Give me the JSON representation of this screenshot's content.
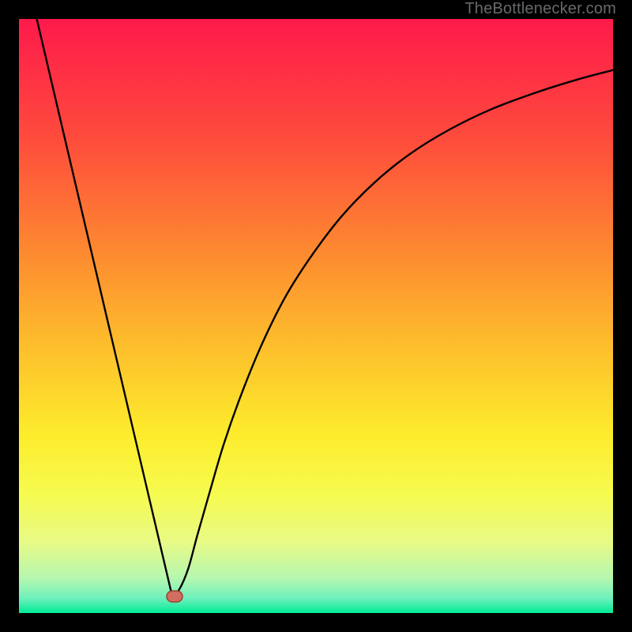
{
  "attribution": "TheBottlenecker.com",
  "chart_data": {
    "type": "line",
    "title": "",
    "xlabel": "",
    "ylabel": "",
    "xlim": [
      0,
      1
    ],
    "ylim": [
      0,
      1
    ],
    "background": {
      "type": "vertical-gradient",
      "stops": [
        {
          "pos": 0.0,
          "color": "#FE1A4B"
        },
        {
          "pos": 0.2,
          "color": "#FE4B3C"
        },
        {
          "pos": 0.4,
          "color": "#FD8C30"
        },
        {
          "pos": 0.55,
          "color": "#FDBE2C"
        },
        {
          "pos": 0.7,
          "color": "#FDEC2C"
        },
        {
          "pos": 0.8,
          "color": "#F6FB4F"
        },
        {
          "pos": 0.88,
          "color": "#E8FA85"
        },
        {
          "pos": 0.94,
          "color": "#B7F7AF"
        },
        {
          "pos": 0.975,
          "color": "#6FF1BC"
        },
        {
          "pos": 1.0,
          "color": "#00EB96"
        }
      ]
    },
    "series": [
      {
        "name": "left-branch",
        "x": [
          0.03,
          0.258
        ],
        "y": [
          1.0,
          0.028
        ]
      },
      {
        "name": "right-branch",
        "x": [
          0.258,
          0.27,
          0.285,
          0.3,
          0.32,
          0.345,
          0.375,
          0.41,
          0.45,
          0.495,
          0.545,
          0.6,
          0.66,
          0.725,
          0.795,
          0.87,
          0.94,
          1.0
        ],
        "y": [
          0.028,
          0.04,
          0.075,
          0.13,
          0.2,
          0.285,
          0.37,
          0.455,
          0.535,
          0.605,
          0.67,
          0.726,
          0.774,
          0.814,
          0.848,
          0.876,
          0.898,
          0.914
        ]
      }
    ],
    "marker": {
      "shape": "pill",
      "x": 0.262,
      "y": 0.028,
      "fill": "#D26E5F",
      "stroke": "#9E4034"
    }
  }
}
